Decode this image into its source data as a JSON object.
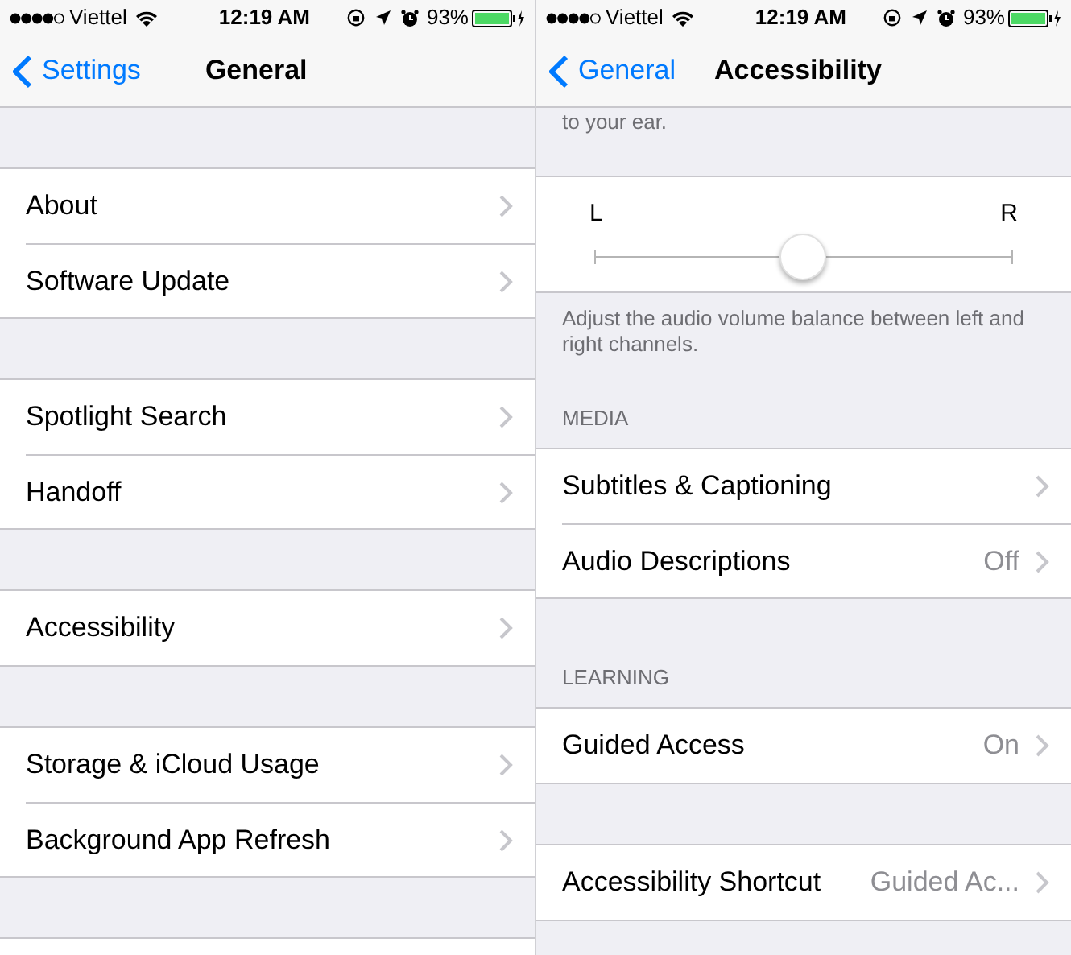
{
  "screens": [
    {
      "status_bar": {
        "carrier": "Viettel",
        "time": "12:19 AM",
        "battery": "93%"
      },
      "nav": {
        "back": "Settings",
        "title": "General"
      },
      "blocks": [
        {
          "kind": "gap"
        },
        {
          "kind": "group",
          "rows": [
            {
              "label": "About"
            },
            {
              "label": "Software Update"
            }
          ]
        },
        {
          "kind": "gap"
        },
        {
          "kind": "group",
          "rows": [
            {
              "label": "Spotlight Search"
            },
            {
              "label": "Handoff"
            }
          ]
        },
        {
          "kind": "gap"
        },
        {
          "kind": "group",
          "rows": [
            {
              "label": "Accessibility"
            }
          ]
        },
        {
          "kind": "gap"
        },
        {
          "kind": "group",
          "rows": [
            {
              "label": "Storage & iCloud Usage"
            },
            {
              "label": "Background App Refresh"
            }
          ]
        },
        {
          "kind": "gap"
        },
        {
          "kind": "blank"
        }
      ]
    },
    {
      "status_bar": {
        "carrier": "Viettel",
        "time": "12:19 AM",
        "battery": "93%"
      },
      "nav": {
        "back": "General",
        "title": "Accessibility"
      },
      "blocks": [
        {
          "kind": "footer",
          "text": "to your ear."
        },
        {
          "kind": "slider",
          "left": "L",
          "right": "R",
          "level": 0.5
        },
        {
          "kind": "footer",
          "text": "Adjust the audio volume balance between left and right channels."
        },
        {
          "kind": "header",
          "text": "MEDIA"
        },
        {
          "kind": "group",
          "rows": [
            {
              "label": "Subtitles & Captioning"
            },
            {
              "label": "Audio Descriptions",
              "value": "Off"
            }
          ]
        },
        {
          "kind": "header",
          "text": "LEARNING"
        },
        {
          "kind": "group",
          "rows": [
            {
              "label": "Guided Access",
              "value": "On"
            }
          ]
        },
        {
          "kind": "gap"
        },
        {
          "kind": "group",
          "rows": [
            {
              "label": "Accessibility Shortcut",
              "value": "Guided Ac..."
            }
          ]
        }
      ]
    }
  ]
}
